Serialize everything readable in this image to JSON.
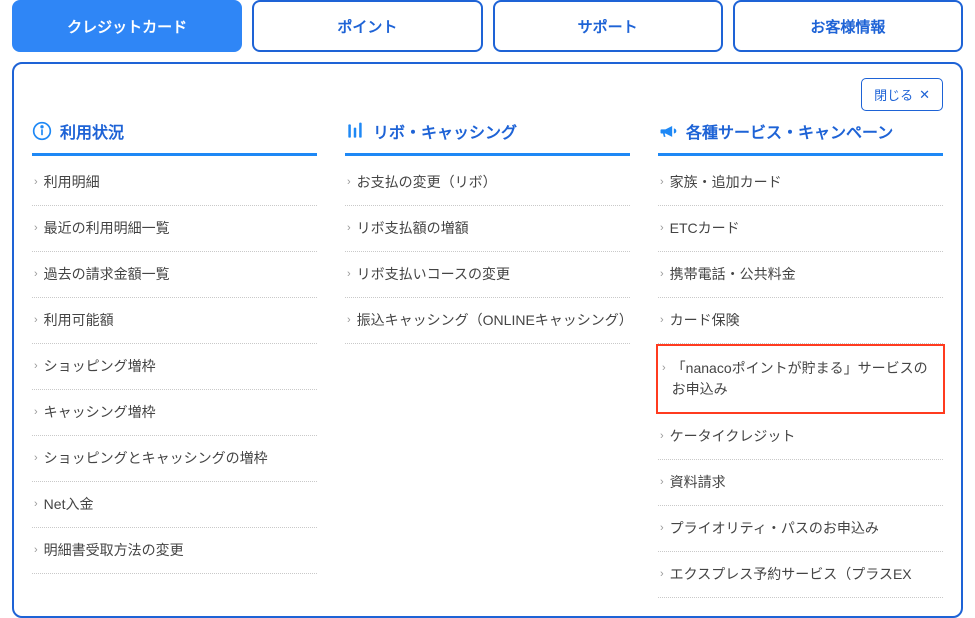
{
  "tabs": [
    {
      "label": "クレジットカード",
      "active": true
    },
    {
      "label": "ポイント",
      "active": false
    },
    {
      "label": "サポート",
      "active": false
    },
    {
      "label": "お客様情報",
      "active": false
    }
  ],
  "close_label": "閉じる",
  "columns": [
    {
      "title": "利用状況",
      "icon": "info",
      "items": [
        {
          "label": "利用明細"
        },
        {
          "label": "最近の利用明細一覧"
        },
        {
          "label": "過去の請求金額一覧"
        },
        {
          "label": "利用可能額"
        },
        {
          "label": "ショッピング増枠"
        },
        {
          "label": "キャッシング増枠"
        },
        {
          "label": "ショッピングとキャッシングの増枠"
        },
        {
          "label": "Net入金"
        },
        {
          "label": "明細書受取方法の変更"
        }
      ]
    },
    {
      "title": "リボ・キャッシング",
      "icon": "sliders",
      "items": [
        {
          "label": "お支払の変更（リボ）"
        },
        {
          "label": "リボ支払額の増額"
        },
        {
          "label": "リボ支払いコースの変更"
        },
        {
          "label": "振込キャッシング（ONLINEキャッシング）"
        }
      ]
    },
    {
      "title": "各種サービス・キャンペーン",
      "icon": "megaphone",
      "items": [
        {
          "label": "家族・追加カード"
        },
        {
          "label": "ETCカード"
        },
        {
          "label": "携帯電話・公共料金"
        },
        {
          "label": "カード保険"
        },
        {
          "label": "「nanacoポイントが貯まる」サービスのお申込み",
          "highlight": true
        },
        {
          "label": "ケータイクレジット"
        },
        {
          "label": "資料請求"
        },
        {
          "label": "プライオリティ・パスのお申込み"
        },
        {
          "label": "エクスプレス予約サービス（プラスEX"
        }
      ]
    }
  ]
}
